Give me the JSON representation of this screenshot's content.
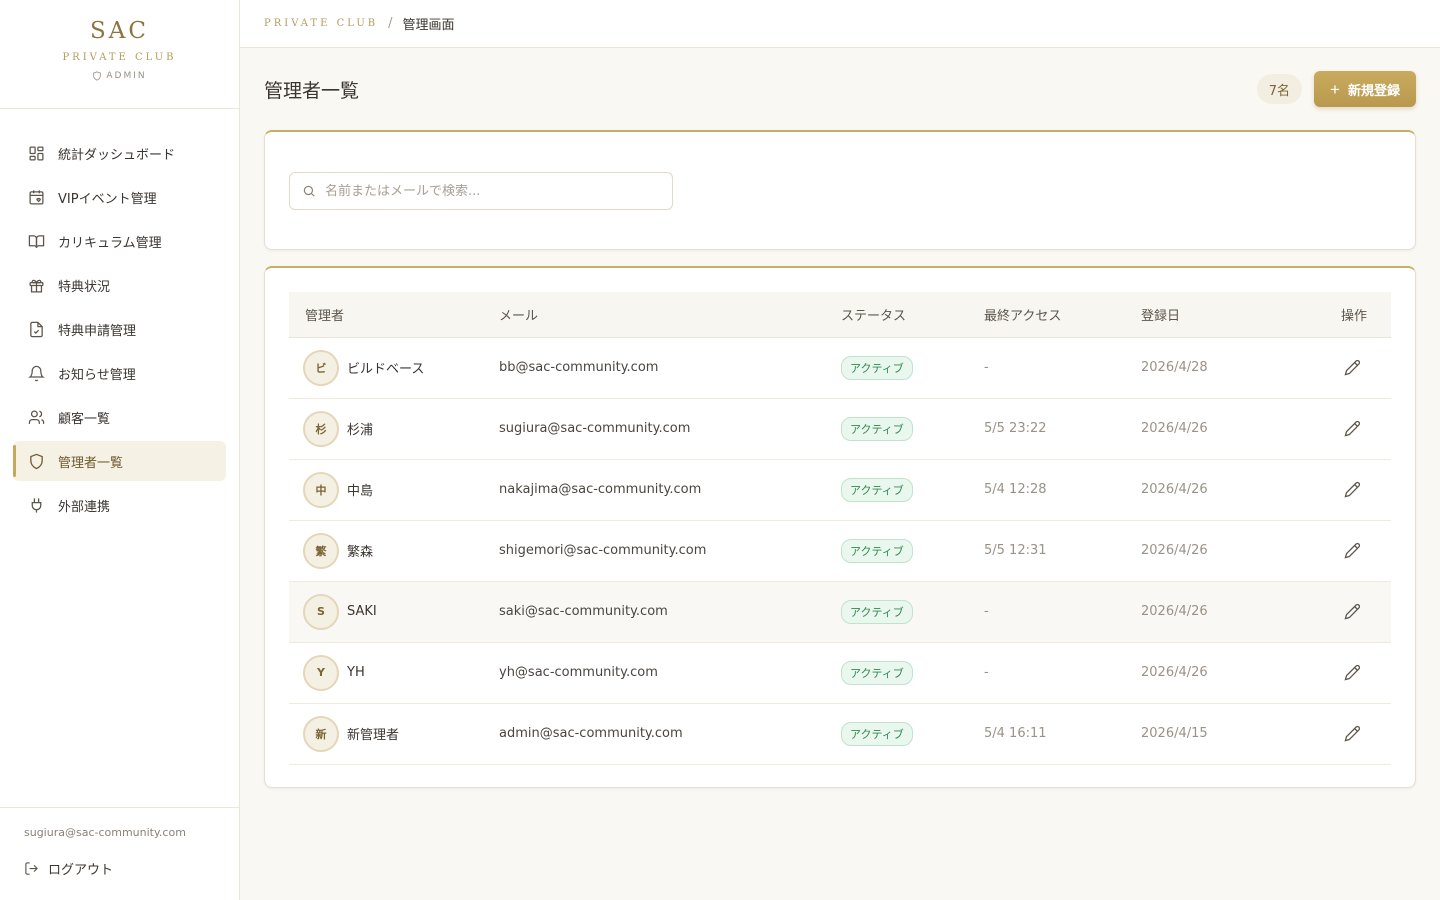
{
  "brand": {
    "name": "SAC",
    "subtitle": "PRIVATE CLUB",
    "badge": "ADMIN",
    "badge_icon": "shield-icon"
  },
  "nav": {
    "items": [
      {
        "id": "dashboard",
        "label": "統計ダッシュボード",
        "icon": "grid-icon"
      },
      {
        "id": "vip",
        "label": "VIPイベント管理",
        "icon": "calendar-heart-icon"
      },
      {
        "id": "curriculum",
        "label": "カリキュラム管理",
        "icon": "book-open-icon"
      },
      {
        "id": "benefits",
        "label": "特典状況",
        "icon": "gift-icon"
      },
      {
        "id": "benefit-requests",
        "label": "特典申請管理",
        "icon": "file-check-icon"
      },
      {
        "id": "notices",
        "label": "お知らせ管理",
        "icon": "bell-icon"
      },
      {
        "id": "customers",
        "label": "顧客一覧",
        "icon": "users-icon"
      },
      {
        "id": "admins",
        "label": "管理者一覧",
        "icon": "shield-icon",
        "active": true
      },
      {
        "id": "integrations",
        "label": "外部連携",
        "icon": "plug-icon"
      }
    ]
  },
  "footer": {
    "email": "sugiura@sac-community.com",
    "logout_label": "ログアウト"
  },
  "breadcrumb": {
    "root": "PRIVATE CLUB",
    "separator": "/",
    "current": "管理画面"
  },
  "page": {
    "title": "管理者一覧",
    "count": "7名",
    "new_label": "新規登録"
  },
  "search": {
    "placeholder": "名前またはメールで検索...",
    "value": ""
  },
  "table": {
    "columns": {
      "admin": "管理者",
      "email": "メール",
      "status": "ステータス",
      "last_access": "最終アクセス",
      "registered": "登録日",
      "actions": "操作"
    },
    "rows": [
      {
        "initial": "ビ",
        "name": "ビルドベース",
        "email": "bb@sac-community.com",
        "status": "アクティブ",
        "last_access": "-",
        "registered": "2026/4/28"
      },
      {
        "initial": "杉",
        "name": "杉浦",
        "email": "sugiura@sac-community.com",
        "status": "アクティブ",
        "last_access": "5/5 23:22",
        "registered": "2026/4/26"
      },
      {
        "initial": "中",
        "name": "中島",
        "email": "nakajima@sac-community.com",
        "status": "アクティブ",
        "last_access": "5/4 12:28",
        "registered": "2026/4/26"
      },
      {
        "initial": "繁",
        "name": "繁森",
        "email": "shigemori@sac-community.com",
        "status": "アクティブ",
        "last_access": "5/5 12:31",
        "registered": "2026/4/26"
      },
      {
        "initial": "S",
        "name": "SAKI",
        "email": "saki@sac-community.com",
        "status": "アクティブ",
        "last_access": "-",
        "registered": "2026/4/26"
      },
      {
        "initial": "Y",
        "name": "YH",
        "email": "yh@sac-community.com",
        "status": "アクティブ",
        "last_access": "-",
        "registered": "2026/4/26"
      },
      {
        "initial": "新",
        "name": "新管理者",
        "email": "admin@sac-community.com",
        "status": "アクティブ",
        "last_access": "5/4 16:11",
        "registered": "2026/4/15"
      }
    ]
  },
  "colors": {
    "accent": "#c4a85c",
    "status_green": "#2e8a4e",
    "background": "#faf8f3"
  }
}
